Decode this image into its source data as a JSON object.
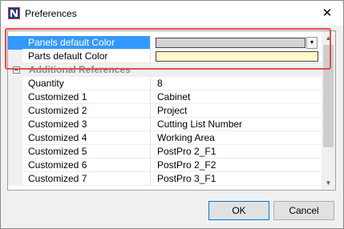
{
  "window": {
    "title": "Preferences",
    "close_glyph": "✕",
    "app_icon": "app-logo-icon"
  },
  "grid": {
    "color_rows": [
      {
        "name": "Panels default Color",
        "value_color": "#d4d4d4",
        "selected": true,
        "has_dropdown": true
      },
      {
        "name": "Parts default Color",
        "value_color": "#fff7cc",
        "selected": false,
        "has_dropdown": false
      }
    ],
    "category": {
      "label": "Additional References",
      "expander": "–"
    },
    "rows": [
      {
        "name": "Quantity",
        "value": "8"
      },
      {
        "name": "Customized 1",
        "value": "Cabinet"
      },
      {
        "name": "Customized 2",
        "value": "Project"
      },
      {
        "name": "Customized 3",
        "value": "Cutting List Number"
      },
      {
        "name": "Customized 4",
        "value": "Working Area"
      },
      {
        "name": "Customized 5",
        "value": "PostPro 2_F1"
      },
      {
        "name": "Customized 6",
        "value": "PostPro 2_F2"
      },
      {
        "name": "Customized 7",
        "value": "PostPro 3_F1"
      }
    ],
    "dropdown_glyph": "▼",
    "scroll_up_glyph": "▲",
    "scroll_down_glyph": "▼"
  },
  "buttons": {
    "ok": "OK",
    "cancel": "Cancel"
  },
  "colors": {
    "selection": "#3399ff",
    "highlight_box": "#e0504c"
  }
}
